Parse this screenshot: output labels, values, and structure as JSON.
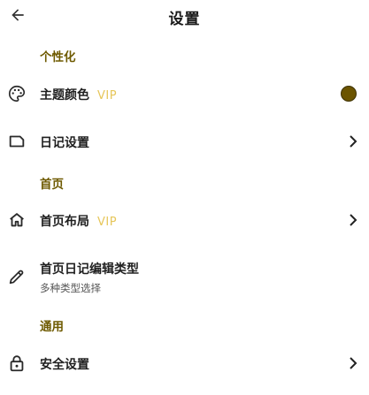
{
  "header": {
    "title": "设置"
  },
  "sections": {
    "personalize": "个性化",
    "home": "首页",
    "general": "通用"
  },
  "rows": {
    "theme_color": {
      "label": "主题颜色",
      "badge": "VIP",
      "color": "#6b5400"
    },
    "diary_settings": {
      "label": "日记设置"
    },
    "home_layout": {
      "label": "首页布局",
      "badge": "VIP"
    },
    "home_diary_edit_type": {
      "label": "首页日记编辑类型",
      "subtitle": "多种类型选择"
    },
    "security_settings": {
      "label": "安全设置"
    }
  },
  "colors": {
    "section_header": "#6e5a00",
    "vip": "#e6c65a",
    "text": "#1f1f1f"
  },
  "icons": {
    "back": "arrow-left-icon",
    "theme": "palette-icon",
    "diary": "label-tag-icon",
    "home": "home-icon",
    "edit": "pencil-icon",
    "security": "lock-icon",
    "chevron": "chevron-right-icon"
  }
}
